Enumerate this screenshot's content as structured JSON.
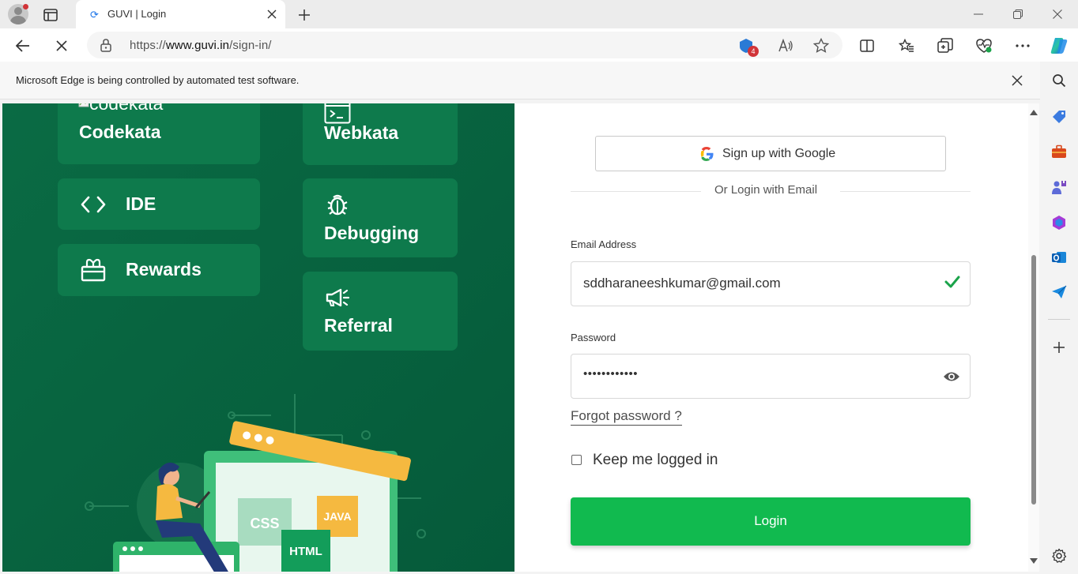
{
  "browser": {
    "tab_title": "GUVI | Login",
    "url_prefix": "https://",
    "url_host": "www.guvi.in",
    "url_path": "/sign-in/",
    "extension_badge": "4",
    "infobar_text": "Microsoft Edge is being controlled by automated test software."
  },
  "left_panel": {
    "broken_image_alt": "codekata",
    "cards": {
      "codekata": "Codekata",
      "webkata": "Webkata",
      "ide": "IDE",
      "debugging": "Debugging",
      "rewards": "Rewards",
      "referral": "Referral"
    },
    "illustration": {
      "css": "CSS",
      "java": "JAVA",
      "html": "HTML"
    }
  },
  "login_form": {
    "google_button": "Sign up with Google",
    "divider_text": "Or Login with Email",
    "email_label": "Email Address",
    "email_value": "sddharaneeshkumar@gmail.com",
    "password_label": "Password",
    "password_value": "••••••••••••",
    "forgot_password": "Forgot password ?",
    "keep_logged_in": "Keep me logged in",
    "login_button": "Login"
  },
  "colors": {
    "panel_green": "#0a6b44",
    "card_green": "#0e7a4c",
    "login_green": "#11ba4f",
    "check_green": "#1aa34a"
  }
}
